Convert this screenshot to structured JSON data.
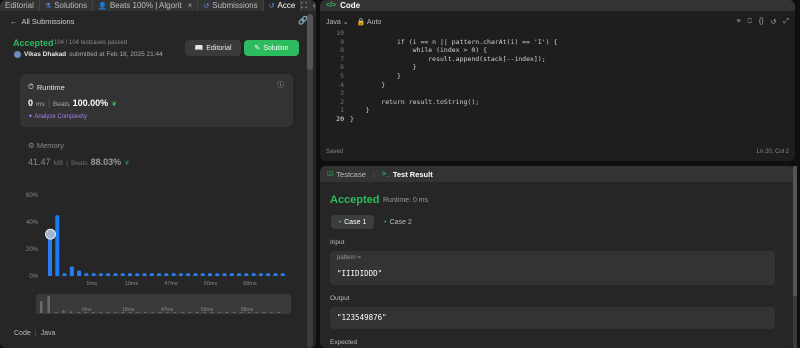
{
  "tabs": [
    {
      "label": "Editorial",
      "icon": "book-icon",
      "active": false
    },
    {
      "label": "Solutions",
      "icon": "flask-icon",
      "active": false
    },
    {
      "label": "Beats 100% | Algorit",
      "icon": "user-icon",
      "active": false
    },
    {
      "label": "Submissions",
      "icon": "history-icon",
      "active": false
    },
    {
      "label": "Acce",
      "icon": "history-icon",
      "active": true
    }
  ],
  "tab_close": "×",
  "left": {
    "back_label": "All Submissions",
    "status": "Accepted",
    "testcases": "104 / 104 testcases passed",
    "user": "Vikas Dhakad",
    "submitted": "submitted at Feb 18, 2025 21:44",
    "editorial_btn": "Editorial",
    "solution_btn": "Solution",
    "runtime": {
      "label": "Runtime",
      "value": "0",
      "unit": "ms",
      "beats_label": "Beats",
      "beats": "100.00%",
      "analyze": "Analyze Complexity"
    },
    "memory": {
      "label": "Memory",
      "value": "41.47",
      "unit": "MB",
      "beats_label": "Beats",
      "beats": "88.03%"
    },
    "mini_labels": [
      "5ms",
      "10ms",
      "47ms",
      "50ms",
      "88ms"
    ],
    "code_label": "Code",
    "code_lang": "Java"
  },
  "chart_data": {
    "type": "bar",
    "title": "",
    "xlabel": "",
    "ylabel": "",
    "ylim": [
      0,
      60
    ],
    "yticks": [
      "0%",
      "20%",
      "40%",
      "60%"
    ],
    "xticks": [
      "5ms",
      "10ms",
      "47ms",
      "50ms",
      "88ms"
    ],
    "highlight_index": 1,
    "values": [
      31,
      45,
      2,
      7,
      4,
      2,
      2,
      2,
      2,
      2,
      2,
      2,
      2,
      2,
      2,
      2,
      2,
      2,
      2,
      2,
      2,
      2,
      2,
      2,
      2,
      2,
      2,
      2,
      2,
      2,
      2,
      2,
      2
    ]
  },
  "editor": {
    "header": "Code",
    "language": "Java",
    "mode": "Auto",
    "saved": "Saved",
    "position": "Ln 20, Col 2",
    "lines": [
      {
        "n": "10",
        "code": ""
      },
      {
        "n": "9",
        "code": "            if (i == n || pattern.charAt(i) == 'I') {"
      },
      {
        "n": "8",
        "code": "                while (index > 0) {"
      },
      {
        "n": "7",
        "code": "                    result.append(stack[--index]);"
      },
      {
        "n": "6",
        "code": "                }"
      },
      {
        "n": "5",
        "code": "            }"
      },
      {
        "n": "4",
        "code": "        }"
      },
      {
        "n": "3",
        "code": ""
      },
      {
        "n": "2",
        "code": "        return result.toString();"
      },
      {
        "n": "1",
        "code": "    }"
      },
      {
        "n": "20",
        "code": "}"
      }
    ]
  },
  "result": {
    "testcase_tab": "Testcase",
    "result_tab": "Test Result",
    "status": "Accepted",
    "runtime": "Runtime: 0 ms",
    "case1": "Case 1",
    "case2": "Case 2",
    "input_label": "Input",
    "var_name": "pattern =",
    "var_value": "\"IIIDIDDD\"",
    "output_label": "Output",
    "output_value": "\"123549876\"",
    "expected_label": "Expected"
  }
}
